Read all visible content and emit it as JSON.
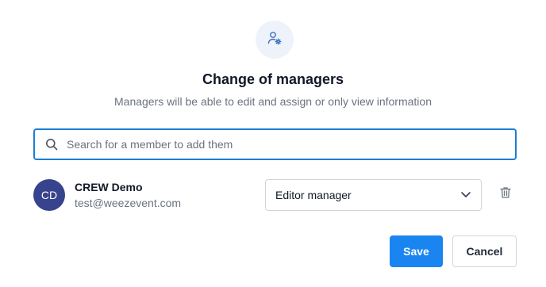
{
  "dialog": {
    "icon": "user-gear-icon",
    "title": "Change of managers",
    "subtitle": "Managers will be able to edit and assign or only view information"
  },
  "search": {
    "placeholder": "Search for a member to add them",
    "value": "",
    "icon": "search-icon"
  },
  "members": [
    {
      "initials": "CD",
      "name": "CREW Demo",
      "email": "test@weezevent.com",
      "role": "Editor manager"
    }
  ],
  "actions": {
    "save_label": "Save",
    "cancel_label": "Cancel"
  },
  "colors": {
    "accent": "#1a85f0",
    "search_border": "#1c7dd3",
    "avatar_bg": "#38438d",
    "icon_circle_bg": "#eef3fb"
  }
}
